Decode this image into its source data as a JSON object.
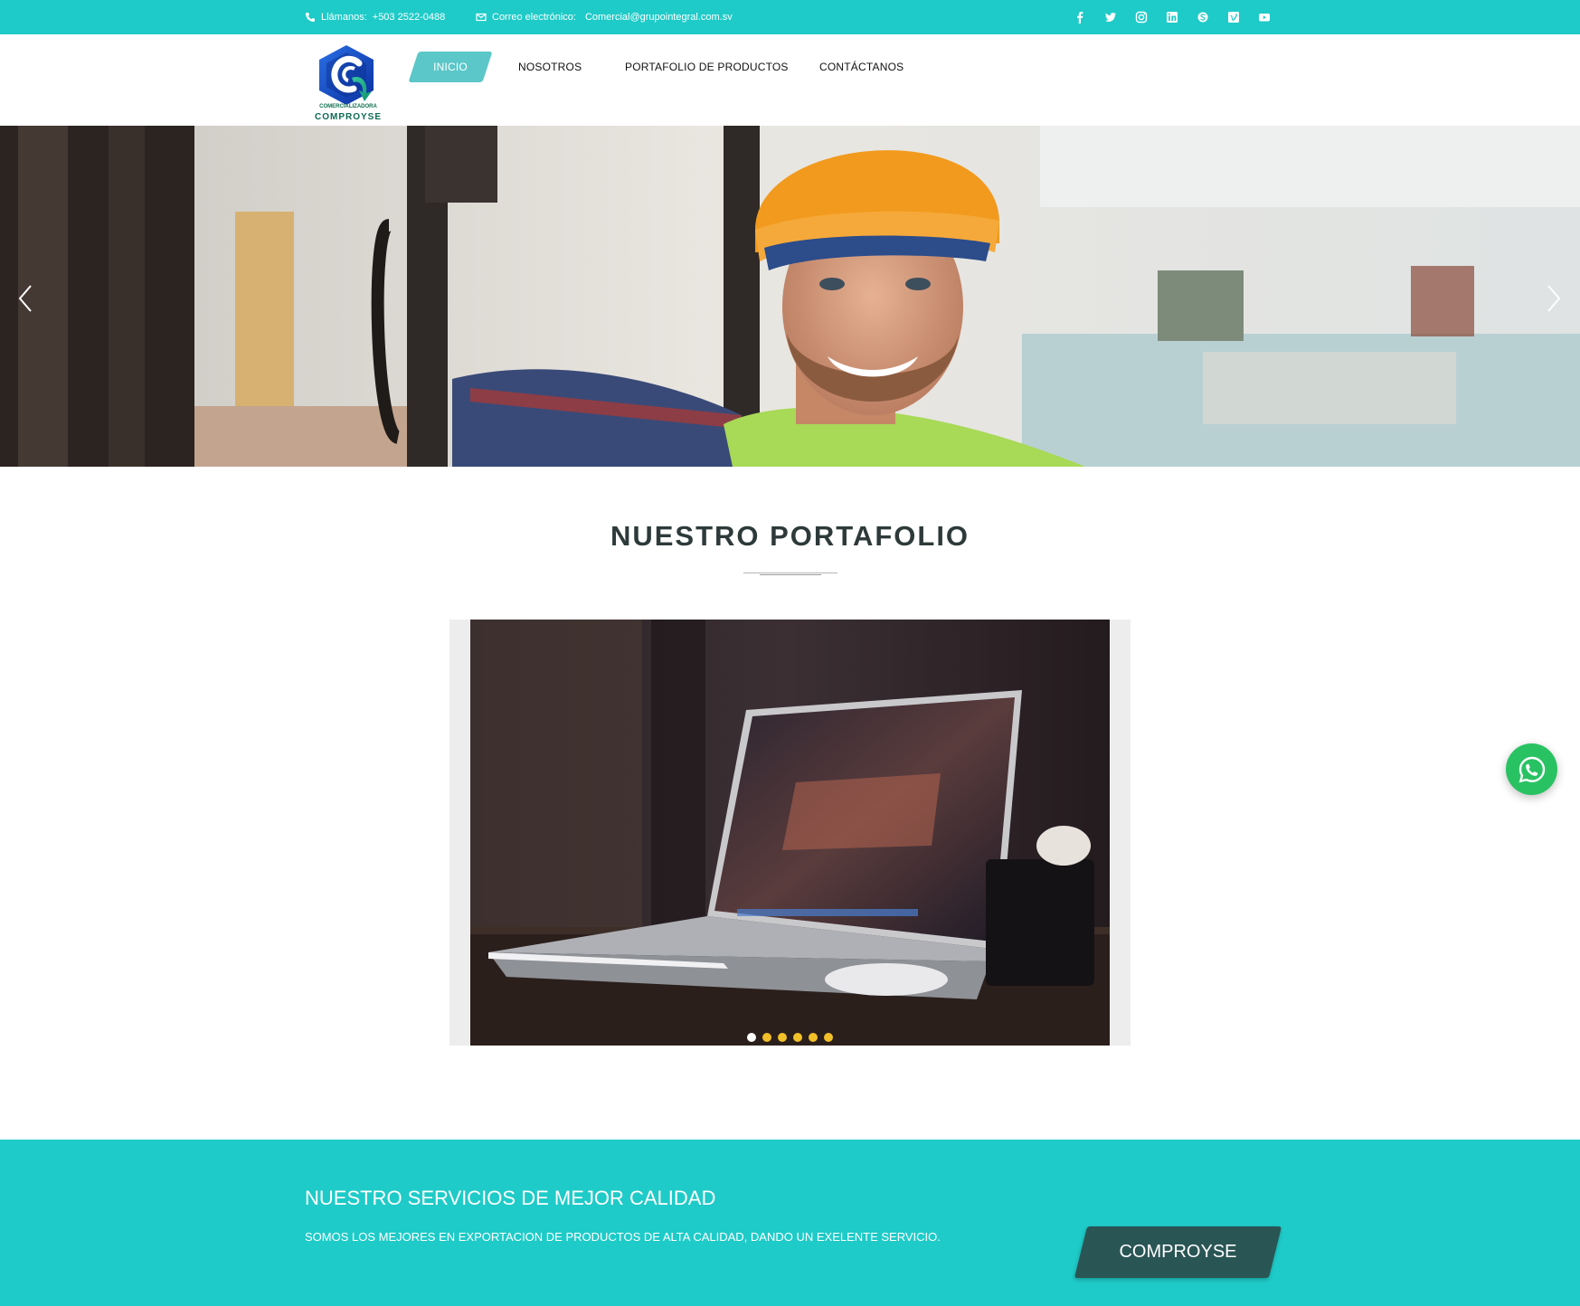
{
  "topbar": {
    "phone_label": "Llámanos:",
    "phone": "+503 2522-0488",
    "email_label": "Correo electrónico:",
    "email": "Comercial@grupointegral.com.sv",
    "social_icons": [
      "facebook-icon",
      "twitter-icon",
      "instagram-icon",
      "linkedin-icon",
      "skype-icon",
      "vimeo-icon",
      "youtube-icon"
    ]
  },
  "logo": {
    "sub": "COMERCIALIZADORA",
    "name": "COMPROYSE"
  },
  "nav": {
    "items": [
      {
        "label": "INICIO",
        "active": true
      },
      {
        "label": "NOSOTROS",
        "active": false
      },
      {
        "label": "PORTAFOLIO DE PRODUCTOS",
        "active": false
      },
      {
        "label": "CONTÁCTANOS",
        "active": false
      }
    ]
  },
  "portfolio": {
    "title": "NUESTRO PORTAFOLIO",
    "slide_count": 6,
    "active_slide": 1
  },
  "banner": {
    "title": "NUESTRO SERVICIOS DE MEJOR CALIDAD",
    "text": "SOMOS LOS MEJORES EN EXPORTACION DE PRODUCTOS DE ALTA CALIDAD, DANDO UN EXELENTE SERVICIO.",
    "button": "COMPROYSE"
  },
  "colors": {
    "accent": "#1ecbc8",
    "nav_active": "#5bc7c9",
    "dot": "#f2c029",
    "whatsapp": "#29c263",
    "button": "#2a5555"
  }
}
